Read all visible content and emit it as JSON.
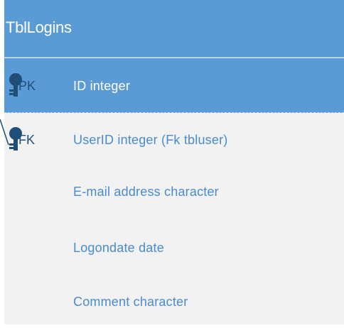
{
  "entity": {
    "title": "TblLogins",
    "fields": [
      {
        "key": "PK",
        "text": "ID integer"
      },
      {
        "key": "FK",
        "text": "UserID integer (Fk tbluser)"
      },
      {
        "key": "",
        "text": "E-mail address character"
      },
      {
        "key": "",
        "text": "Logondate date"
      },
      {
        "key": "",
        "text": "Comment character"
      }
    ]
  },
  "colors": {
    "header": "#5b9bd5",
    "body": "#f2f2f2",
    "key_icon": "#1f4e79",
    "field_text": "#4a8bcf"
  }
}
